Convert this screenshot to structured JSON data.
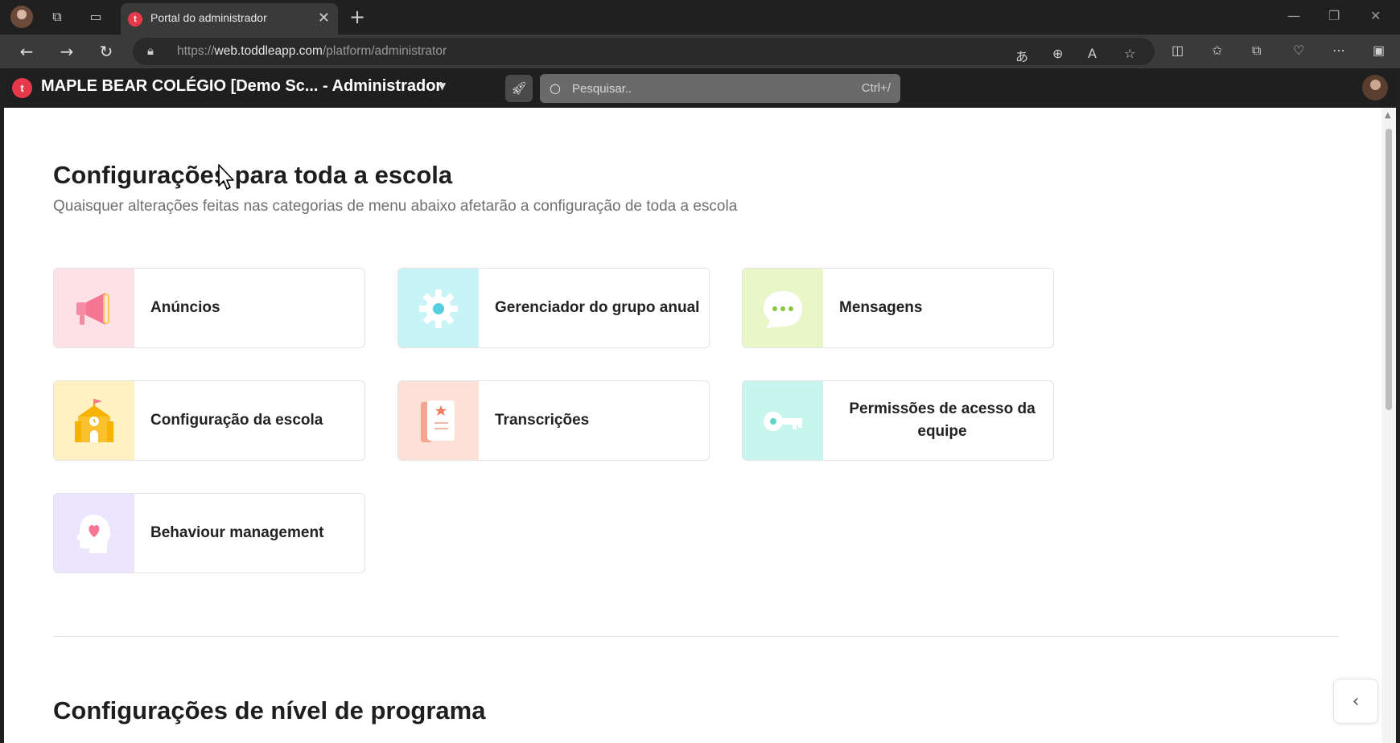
{
  "browser": {
    "tab_title": "Portal do administrador",
    "tab_favicon": "t",
    "url_prefix": "https://",
    "url_host": "web.toddleapp.com",
    "url_path": "/platform/administrator"
  },
  "header": {
    "logo_letter": "t",
    "title": "MAPLE BEAR COLÉGIO [Demo Sc... - Administrador",
    "search_placeholder": "Pesquisar..",
    "search_shortcut": "Ctrl+/"
  },
  "school_settings": {
    "title": "Configurações para toda a escola",
    "subtitle": "Quaisquer alterações feitas nas categorias de menu abaixo afetarão a configuração de toda a escola",
    "cards": [
      {
        "label": "Anúncios",
        "icon": "megaphone-icon",
        "bg": "#fde1e6"
      },
      {
        "label": "Gerenciador do grupo anual",
        "icon": "gear-icon",
        "bg": "#c8f3f7"
      },
      {
        "label": "Mensagens",
        "icon": "chat-bubble-icon",
        "bg": "#e8f6c8"
      },
      {
        "label": "Configuração da escola",
        "icon": "school-building-icon",
        "bg": "#fff1c2"
      },
      {
        "label": "Transcrições",
        "icon": "notebook-icon",
        "bg": "#fde0d8"
      },
      {
        "label": "Permissões de acesso da equipe",
        "icon": "key-icon",
        "bg": "#c9f5ef"
      },
      {
        "label": "Behaviour management",
        "icon": "head-heart-icon",
        "bg": "#ebe6fd"
      }
    ]
  },
  "program_settings": {
    "title": "Configurações de nível de programa"
  },
  "icons": {
    "back": "arrow-left-icon",
    "forward": "arrow-right-icon",
    "refresh": "refresh-icon",
    "lock": "lock-icon",
    "rocket": "rocket-icon",
    "search": "search-icon",
    "collapse": "chevron-left-icon"
  },
  "colors": {
    "brand": "#e8394a",
    "header_bg": "#1f1f1f"
  }
}
